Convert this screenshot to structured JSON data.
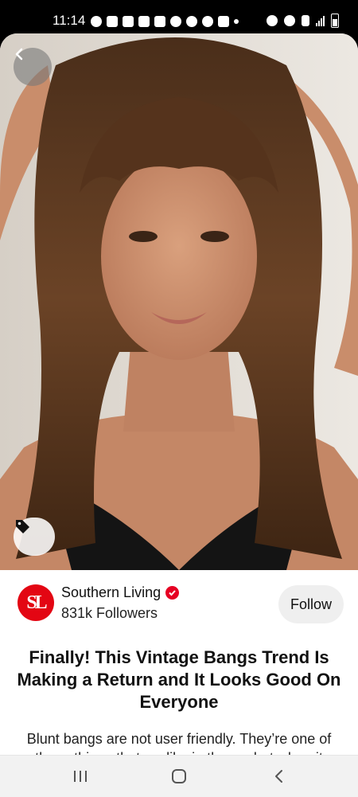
{
  "status_bar": {
    "time": "11:14"
  },
  "profile": {
    "name": "Southern Living",
    "followers": "831k Followers",
    "avatar_text": "SL",
    "follow_label": "Follow"
  },
  "pin": {
    "title": "Finally! This Vintage Bangs Trend Is Making a Return and It Looks Good On Everyone",
    "description": "Blunt bangs are not user friendly. They’re one of those things that we like in theory, but when it"
  },
  "icons": {
    "back": "chevron-left-icon",
    "tag": "tag-icon",
    "verified": "verified-check-icon",
    "nav_recents": "recents-icon",
    "nav_home": "home-icon",
    "nav_back": "back-icon"
  },
  "colors": {
    "brand_red": "#e60023",
    "avatar_red": "#e30613"
  }
}
